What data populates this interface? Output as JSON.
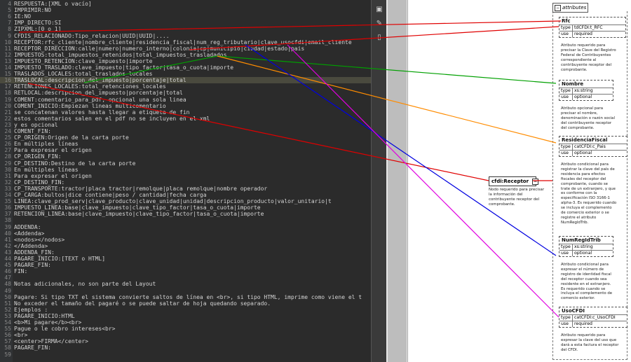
{
  "editor": {
    "lines": [
      {
        "n": "4",
        "text": "RESPUESTA:[XML o vacío]"
      },
      {
        "n": "5",
        "text": "IMPRIMIR:NO"
      },
      {
        "n": "6",
        "text": "IE:NO"
      },
      {
        "n": "7",
        "text": "IMP_DIRECTO:SI"
      },
      {
        "n": "8",
        "text": "ZIPXML:[0 o 1]"
      },
      {
        "n": "9",
        "text": "CFDIS_RELACIONADO:Tipo_relacion|UUID|UUID|...."
      },
      {
        "n": "10",
        "text": "RECEPTOR:rfc_cliente|nombre_cliente|residencia_fiscal|num_reg_tributario|clave_usocfdi|email_cliente"
      },
      {
        "n": "11",
        "text": "RECEPTOR_DIRECCION:calle|numero|numero_interno|colonia|cp|municipio|ciudad|estado|pais"
      },
      {
        "n": "12",
        "text": "IMPUESTOS:total_impuestos_retenidos|total_impuestos_trasladados"
      },
      {
        "n": "13",
        "text": "IMPUESTO_RETENCION:clave_impuesto|importe"
      },
      {
        "n": "14",
        "text": "IMPUESTO_TRASLADO:clave_impuesto|tipo_factor|tasa_o_cuota|importe"
      },
      {
        "n": "15",
        "text": "TRASLADOS_LOCALES:total_traslados_locales"
      },
      {
        "n": "16",
        "text": "TRASLOCAL:descripcion_del_impuesto|porcentaje|total"
      },
      {
        "n": "17",
        "text": "RETENCIONES_LOCALES:total_retenciones_locales"
      },
      {
        "n": "18",
        "text": "RETLOCAL:descripcion_del_impuesto|porcentaje|total"
      },
      {
        "n": "19",
        "text": "COMENT:comentario_para_pdf, opcional una sola linea"
      },
      {
        "n": "20",
        "text": "COMENT_INICIO:Empiezan lineas multicomentario"
      },
      {
        "n": "21",
        "text": "se concatenan valores hasta llegar a etiqueta de fin"
      },
      {
        "n": "22",
        "text": "estos comentarios salen en el pdf no se incluyen en el xml"
      },
      {
        "n": "23",
        "text": "y es opcional"
      },
      {
        "n": "24",
        "text": "COMENT_FIN:"
      },
      {
        "n": "25",
        "text": "CP_ORIGEN:Origen de la carta porte"
      },
      {
        "n": "26",
        "text": "En múltiples líneas"
      },
      {
        "n": "27",
        "text": "Para expresar el origen"
      },
      {
        "n": "28",
        "text": "CP_ORIGEN_FIN:"
      },
      {
        "n": "29",
        "text": "CP_DESTINO:Destino de la carta porte"
      },
      {
        "n": "30",
        "text": "En múltiples líneas"
      },
      {
        "n": "31",
        "text": "Para expresar el origen"
      },
      {
        "n": "32",
        "text": "CP_DESTINO_FIN:"
      },
      {
        "n": "33",
        "text": "CP_TRANSPORTE:tractor|placa tractor|remolque|placa remolque|nombre operador"
      },
      {
        "n": "34",
        "text": "CP_CARGA:bultos|dice contiene|peso / cantidad|fecha carga"
      },
      {
        "n": "35",
        "text": "LINEA:clave_prod_serv|clave_producto|clave_unidad|unidad|descripcion_producto|valor_unitario|t"
      },
      {
        "n": "36",
        "text": "IMPUESTO_LINEA:base|clave_impuesto|clave_tipo_factor|tasa_o_cuota|importe"
      },
      {
        "n": "37",
        "text": "RETENCION_LINEA:base|clave_impuesto|clave_tipo_factor|tasa_o_cuota|importe"
      },
      {
        "n": "38",
        "text": ""
      },
      {
        "n": "39",
        "text": "ADDENDA:"
      },
      {
        "n": "40",
        "text": "<Addenda>"
      },
      {
        "n": "41",
        "text": "<nodos></nodos>"
      },
      {
        "n": "42",
        "text": "</Addenda>"
      },
      {
        "n": "43",
        "text": "ADDENDA_FIN:"
      },
      {
        "n": "44",
        "text": "PAGARE_INICIO:[TEXT o HTML]"
      },
      {
        "n": "45",
        "text": "PAGARE_FIN:"
      },
      {
        "n": "46",
        "text": "FIN:"
      },
      {
        "n": "47",
        "text": ""
      },
      {
        "n": "48",
        "text": "Notas adicionales, no son parte del Layout"
      },
      {
        "n": "49",
        "text": ""
      },
      {
        "n": "50",
        "text": "Pagare: Si tipo TXT el sistema convierte saltos de línea en <br>, si tipo HTML, imprime como viene el t"
      },
      {
        "n": "51",
        "text": "No exceder el tamaño del pagaré o se puede saltar de hoja quedando separado."
      },
      {
        "n": "52",
        "text": "Ejemplos :"
      },
      {
        "n": "53",
        "text": "PAGARE_INICIO:HTML"
      },
      {
        "n": "54",
        "text": "<b>Mi pagare</b><br>"
      },
      {
        "n": "55",
        "text": "Pague o le cobro intereses<br>"
      },
      {
        "n": "56",
        "text": "<br>"
      },
      {
        "n": "57",
        "text": "<center>FIRMA</center>"
      },
      {
        "n": "58",
        "text": "PAGARE_FIN:"
      },
      {
        "n": "59",
        "text": ""
      }
    ]
  },
  "toolbar": {
    "icons": [
      "image-icon",
      "pen-icon",
      "page-icon"
    ]
  },
  "diagram": {
    "attributes_header": "attributes",
    "receptor_label": "cfdi:Receptor",
    "receptor_desc": [
      "Nodo requerido para precisar",
      "la información del",
      "contribuyente receptor del",
      "comprobante."
    ],
    "attrs": [
      {
        "name": "Rfc",
        "type_key": "type",
        "type_val": "tdCFDI:t_RFC",
        "use_key": "use",
        "use_val": "required",
        "desc": [
          "Atributo requerido para",
          "precisar la Clave del Registro",
          "Federal de Contribuyentes",
          "correspondiente al",
          "contribuyente receptor del",
          "comprobante."
        ]
      },
      {
        "name": "Nombre",
        "type_key": "type",
        "type_val": "xs:string",
        "use_key": "use",
        "use_val": "optional",
        "desc": [
          "Atributo opcional para",
          "precisar el nombre,",
          "denominación o razón social",
          "del contribuyente receptor",
          "del comprobante."
        ]
      },
      {
        "name": "ResidenciaFiscal",
        "type_key": "type",
        "type_val": "catCFDI:c_Pais",
        "use_key": "use",
        "use_val": "optional",
        "desc": [
          "Atributo condicional para",
          "registrar la clave del país de",
          "residencia para efectos",
          "fiscales del receptor del",
          "comprobante, cuando se",
          "trate de un extranjero, y que",
          "es conforme con la",
          "especificación ISO 3166-1",
          "alpha-3. Es requerido cuando",
          "se incluya el complemento",
          "de comercio exterior o se",
          "registre el atributo",
          "NumRegIdTrib."
        ]
      },
      {
        "name": "NumRegIdTrib",
        "type_key": "type",
        "type_val": "xs:string",
        "use_key": "use",
        "use_val": "optional",
        "desc": [
          "Atributo condicional para",
          "expresar el número de",
          "registro de identidad fiscal",
          "del receptor cuando sea",
          "residente en el extranjero.",
          "Es requerido cuando se",
          "incluya el complemento de",
          "comercio exterior."
        ]
      },
      {
        "name": "UsoCFDI",
        "type_key": "type",
        "type_val": "catCFDI:c_UsoCFDI",
        "use_key": "use",
        "use_val": "required",
        "desc": [
          "Atributo requerido para",
          "expresar la clave del uso que",
          "dará a esta factura el receptor",
          "del CFDI."
        ]
      }
    ],
    "line_colors": [
      "#e00000",
      "#00a000",
      "#ff8c00",
      "#0000e0",
      "#e000e0"
    ]
  }
}
